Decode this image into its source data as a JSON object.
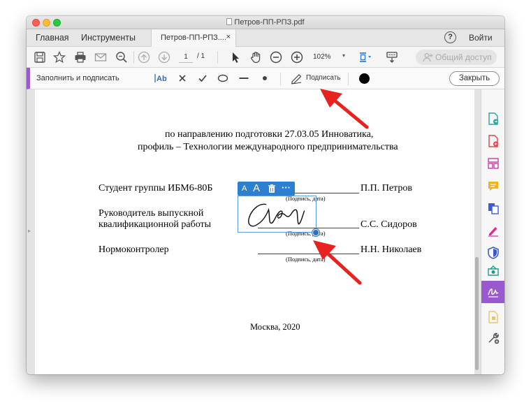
{
  "window": {
    "title": "Петров-ПП-РПЗ.pdf"
  },
  "tabs": {
    "home": "Главная",
    "tools": "Инструменты",
    "file_tab": "Петров-ПП-РПЗ....",
    "close_tab": "×",
    "help": "?",
    "login": "Войти"
  },
  "toolbar": {
    "page_current": "1",
    "page_total": "/ 1",
    "zoom": "102%",
    "zoom_caret": "▾",
    "share_label": "Общий доступ"
  },
  "fill_sign": {
    "title": "Заполнить и подписать",
    "sign_label": "Подписать",
    "close_label": "Закрыть",
    "tools": [
      "text-tool-icon",
      "cross-icon",
      "check-icon",
      "ellipse-icon",
      "line-icon",
      "dot-icon"
    ],
    "ink_color": "#000000"
  },
  "document": {
    "line1": "по направлению подготовки 27.03.05 Инноватика,",
    "line2": "профиль – Технологии международного предпринимательства",
    "student_label": "Студент группы ИБМ6-80Б",
    "student_name": "П.П. Петров",
    "supervisor_label_1": "Руководитель выпускной",
    "supervisor_label_2": "квалификационной работы",
    "supervisor_name": "С.С. Сидоров",
    "normcontrol_label": "Нормоконтролер",
    "normcontrol_name": "Н.Н. Николаев",
    "sig_caption_1": "(Подпись, дата)",
    "sig_caption_2": "(Подпись, дата)",
    "sig_caption_3": "(Подпись, дата)",
    "city_year": "Москва, 2020"
  },
  "signature_toolbar": {
    "shrink": "A",
    "grow": "A",
    "more": "···"
  },
  "colors": {
    "accent_purple": "#9b59d0",
    "selection_blue": "#2d7fd0",
    "arrow_red": "#e8231f"
  },
  "right_rail_icons": [
    "export-pdf-icon",
    "create-pdf-icon",
    "organize-pages-icon",
    "comment-icon",
    "combine-files-icon",
    "fill-sign-icon",
    "protect-icon",
    "send-for-review-icon",
    "request-signatures-icon",
    "rich-media-icon",
    "more-tools-icon"
  ]
}
